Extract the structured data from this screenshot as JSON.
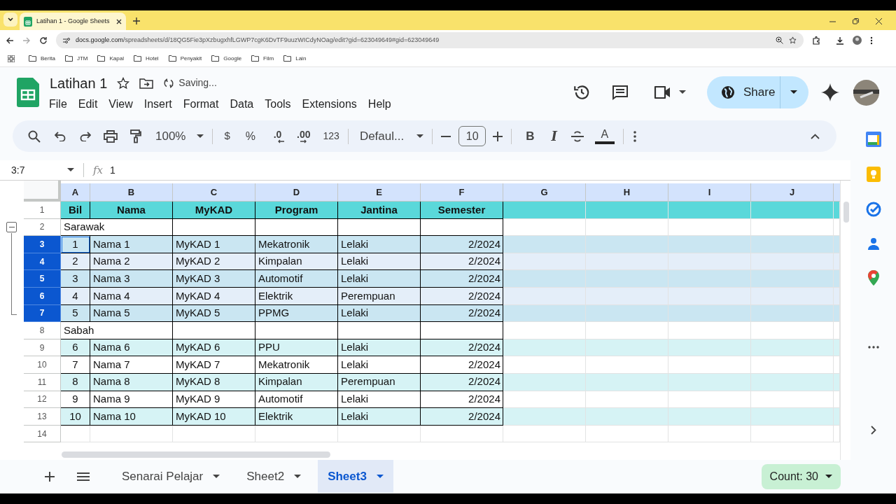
{
  "browser": {
    "tab_title": "Latihan 1 - Google Sheets",
    "url_host": "docs.google.com",
    "url_path": "/spreadsheets/d/18QG5Fie3pXzbugxhfLGWP7cgK6DvTF9uuzWICdyNOag/edit?gid=623049649#gid=623049649",
    "bookmarks": [
      "Berita",
      "JTM",
      "Kapal",
      "Hotel",
      "Penyakit",
      "Google",
      "Film",
      "Lain"
    ]
  },
  "doc": {
    "title": "Latihan 1",
    "status": "Saving...",
    "menu": [
      "File",
      "Edit",
      "View",
      "Insert",
      "Format",
      "Data",
      "Tools",
      "Extensions",
      "Help"
    ],
    "share": "Share"
  },
  "toolbar": {
    "zoom": "100%",
    "currency": "$",
    "percent": "%",
    "decrease_decimal": ".0",
    "increase_decimal": ".00",
    "number_format": "123",
    "font": "Defaul...",
    "font_size": "10",
    "bold": "B",
    "italic": "I",
    "text_color": "A"
  },
  "formula_bar": {
    "name_box": "3:7",
    "fx": "fx",
    "value": "1"
  },
  "columns": [
    "A",
    "B",
    "C",
    "D",
    "E",
    "F",
    "G",
    "H",
    "I",
    "J"
  ],
  "rows": [
    {
      "number": "1",
      "kind": "header",
      "selected": false,
      "cells": [
        "Bil",
        "Nama",
        "MyKAD",
        "Program",
        "Jantina",
        "Semester"
      ]
    },
    {
      "number": "2",
      "kind": "group",
      "selected": false,
      "cells": [
        "Sarawak"
      ]
    },
    {
      "number": "3",
      "kind": "data",
      "selected": true,
      "banded": true,
      "cells": [
        "1",
        "Nama 1",
        "MyKAD 1",
        "Mekatronik",
        "Lelaki",
        "2/2024"
      ]
    },
    {
      "number": "4",
      "kind": "data",
      "selected": true,
      "banded": false,
      "cells": [
        "2",
        "Nama 2",
        "MyKAD 2",
        "Kimpalan",
        "Lelaki",
        "2/2024"
      ]
    },
    {
      "number": "5",
      "kind": "data",
      "selected": true,
      "banded": true,
      "cells": [
        "3",
        "Nama 3",
        "MyKAD 3",
        "Automotif",
        "Lelaki",
        "2/2024"
      ]
    },
    {
      "number": "6",
      "kind": "data",
      "selected": true,
      "banded": false,
      "cells": [
        "4",
        "Nama 4",
        "MyKAD 4",
        "Elektrik",
        "Perempuan",
        "2/2024"
      ]
    },
    {
      "number": "7",
      "kind": "data",
      "selected": true,
      "banded": true,
      "cells": [
        "5",
        "Nama 5",
        "MyKAD 5",
        "PPMG",
        "Lelaki",
        "2/2024"
      ]
    },
    {
      "number": "8",
      "kind": "group",
      "selected": false,
      "cells": [
        "Sabah"
      ]
    },
    {
      "number": "9",
      "kind": "data",
      "selected": false,
      "banded": true,
      "cells": [
        "6",
        "Nama 6",
        "MyKAD 6",
        "PPU",
        "Lelaki",
        "2/2024"
      ]
    },
    {
      "number": "10",
      "kind": "data",
      "selected": false,
      "banded": false,
      "cells": [
        "7",
        "Nama 7",
        "MyKAD 7",
        "Mekatronik",
        "Lelaki",
        "2/2024"
      ]
    },
    {
      "number": "11",
      "kind": "data",
      "selected": false,
      "banded": true,
      "cells": [
        "8",
        "Nama 8",
        "MyKAD 8",
        "Kimpalan",
        "Perempuan",
        "2/2024"
      ]
    },
    {
      "number": "12",
      "kind": "data",
      "selected": false,
      "banded": false,
      "cells": [
        "9",
        "Nama 9",
        "MyKAD 9",
        "Automotif",
        "Lelaki",
        "2/2024"
      ]
    },
    {
      "number": "13",
      "kind": "data",
      "selected": false,
      "banded": true,
      "cells": [
        "10",
        "Nama 10",
        "MyKAD 10",
        "Elektrik",
        "Lelaki",
        "2/2024"
      ]
    },
    {
      "number": "14",
      "kind": "empty",
      "selected": false,
      "banded": false,
      "cells": []
    }
  ],
  "sheets": [
    {
      "label": "Senarai Pelajar",
      "selected": false
    },
    {
      "label": "Sheet2",
      "selected": false
    },
    {
      "label": "Sheet3",
      "selected": true
    }
  ],
  "count": "Count: 30"
}
